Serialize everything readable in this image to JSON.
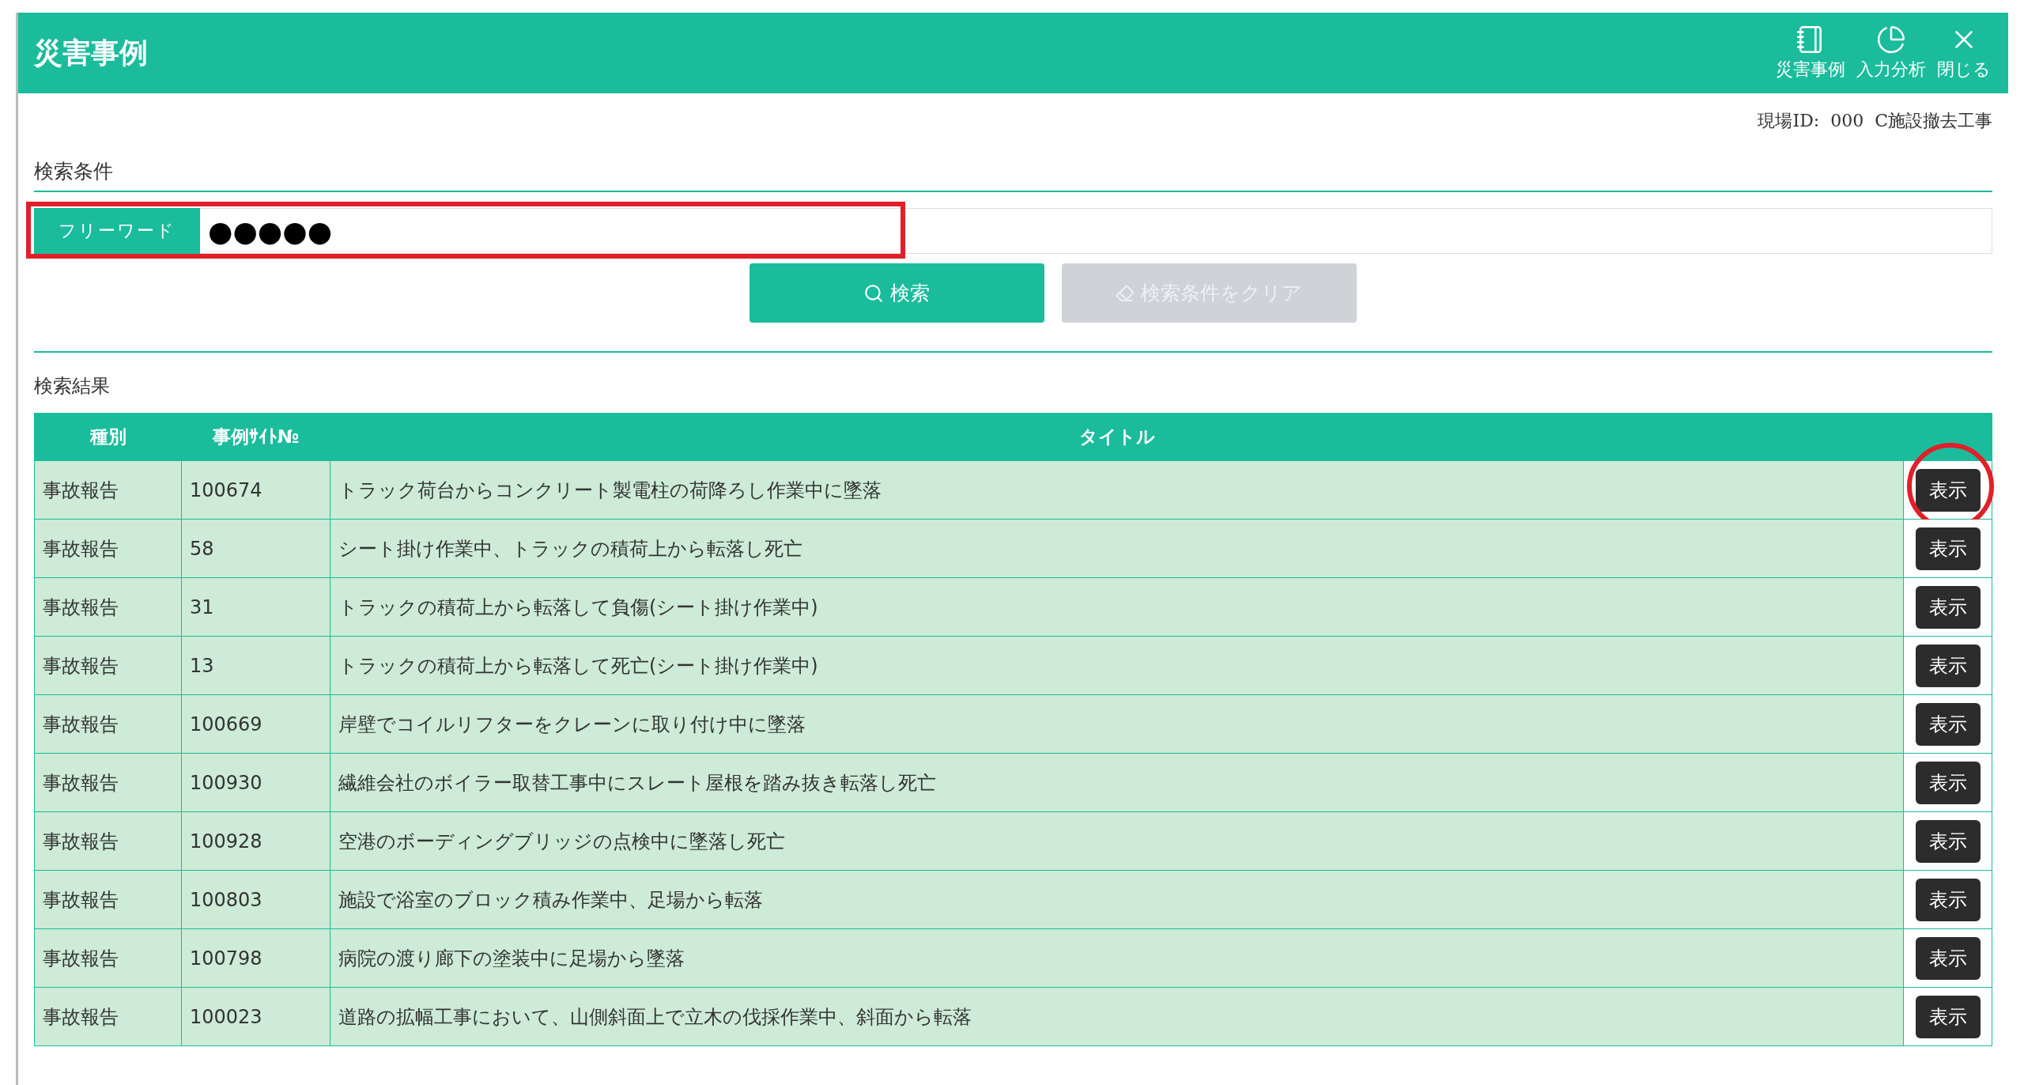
{
  "header": {
    "title": "災害事例",
    "nav_items": [
      {
        "kind": "notebook",
        "label": "災害事例"
      },
      {
        "kind": "chart",
        "label": "入力分析"
      },
      {
        "kind": "close",
        "label": "閉じる"
      }
    ]
  },
  "site_info": "現場ID:  000  C施設撤去工事",
  "search_conditions": {
    "heading": "検索条件",
    "free_word": {
      "label": "フリーワード",
      "value": "●●●●●"
    },
    "buttons": [
      {
        "kind": "search",
        "label": "検索",
        "disabled": false
      },
      {
        "kind": "clear",
        "label": "検索条件をクリア",
        "disabled": true
      }
    ]
  },
  "results": {
    "heading": "検索結果",
    "columns": [
      "種別",
      "事例ｻｲﾄ№",
      "タイトル"
    ],
    "rows": [
      {
        "type": "事故報告",
        "number": "100674",
        "title": "トラック荷台からコンクリート製電柱の荷降ろし作業中に墜落",
        "action": "表示",
        "highlighted": true
      },
      {
        "type": "事故報告",
        "number": "58",
        "title": "シート掛け作業中、トラックの積荷上から転落し死亡",
        "action": "表示",
        "highlighted": false
      },
      {
        "type": "事故報告",
        "number": "31",
        "title": "トラックの積荷上から転落して負傷(シート掛け作業中)",
        "action": "表示",
        "highlighted": false
      },
      {
        "type": "事故報告",
        "number": "13",
        "title": "トラックの積荷上から転落して死亡(シート掛け作業中)",
        "action": "表示",
        "highlighted": false
      },
      {
        "type": "事故報告",
        "number": "100669",
        "title": "岸壁でコイルリフターをクレーンに取り付け中に墜落",
        "action": "表示",
        "highlighted": false
      },
      {
        "type": "事故報告",
        "number": "100930",
        "title": "繊維会社のボイラー取替工事中にスレート屋根を踏み抜き転落し死亡",
        "action": "表示",
        "highlighted": false
      },
      {
        "type": "事故報告",
        "number": "100928",
        "title": "空港のボーディングブリッジの点検中に墜落し死亡",
        "action": "表示",
        "highlighted": false
      },
      {
        "type": "事故報告",
        "number": "100803",
        "title": "施設で浴室のブロック積み作業中、足場から転落",
        "action": "表示",
        "highlighted": false
      },
      {
        "type": "事故報告",
        "number": "100798",
        "title": "病院の渡り廊下の塗装中に足場から墜落",
        "action": "表示",
        "highlighted": false
      },
      {
        "type": "事故報告",
        "number": "100023",
        "title": "道路の拡幅工事において、山側斜面上で立木の伐採作業中、斜面から転落",
        "action": "表示",
        "highlighted": false
      }
    ]
  }
}
